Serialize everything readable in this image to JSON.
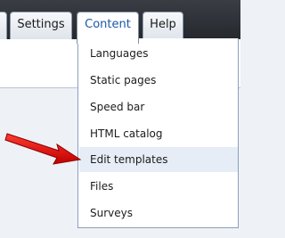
{
  "tabs": [
    {
      "label": ""
    },
    {
      "label": "Settings"
    },
    {
      "label": "Content",
      "active": true
    },
    {
      "label": "Help"
    }
  ],
  "dropdown": {
    "parent_tab": "Content",
    "highlighted": "Edit templates",
    "items": [
      {
        "label": "Languages"
      },
      {
        "label": "Static pages"
      },
      {
        "label": "Speed bar"
      },
      {
        "label": "HTML catalog"
      },
      {
        "label": "Edit templates"
      },
      {
        "label": "Files"
      },
      {
        "label": "Surveys"
      }
    ]
  },
  "annotation": {
    "icon": "red-pointer-arrow-icon",
    "color": "#e01010"
  },
  "colors": {
    "topbar": "#2e3136",
    "active_tab_text": "#1b57a8",
    "menu_border": "#8aa0bd",
    "menu_hover": "#e6edf6",
    "page_background": "#eef1f6"
  }
}
